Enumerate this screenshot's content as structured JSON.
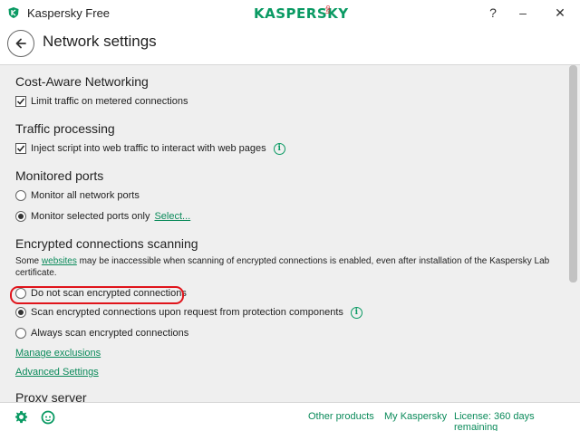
{
  "window": {
    "title": "Kaspersky Free",
    "logo_text": "KASPERSKY",
    "logo_suffix": "lab",
    "colors": {
      "brand_green": "#0a9a63",
      "brand_red": "#d7232a",
      "content_bg": "#efefef",
      "highlight": "#e0141b"
    }
  },
  "header": {
    "title": "Network settings"
  },
  "sections": {
    "cost_aware": {
      "title": "Cost-Aware Networking",
      "limit_traffic": {
        "label": "Limit traffic on metered connections",
        "checked": true
      }
    },
    "traffic_processing": {
      "title": "Traffic processing",
      "inject_script": {
        "label": "Inject script into web traffic to interact with web pages",
        "checked": true
      }
    },
    "monitored_ports": {
      "title": "Monitored ports",
      "all_ports": {
        "label": "Monitor all network ports",
        "selected": false
      },
      "selected_ports": {
        "label": "Monitor selected ports only",
        "selected": true,
        "link": "Select..."
      }
    },
    "encrypted": {
      "title": "Encrypted connections scanning",
      "desc_pre": "Some ",
      "desc_link": "websites",
      "desc_post": " may be inaccessible when scanning of encrypted connections is enabled, even after installation of the Kaspersky Lab certificate.",
      "do_not_scan": {
        "label": "Do not scan encrypted connections",
        "selected": false
      },
      "on_request": {
        "label": "Scan encrypted connections upon request from protection components",
        "selected": true
      },
      "always": {
        "label": "Always scan encrypted connections",
        "selected": false
      },
      "manage_exclusions": "Manage exclusions",
      "advanced_settings": "Advanced Settings"
    },
    "proxy": {
      "title": "Proxy server"
    }
  },
  "footer": {
    "other_products": "Other products",
    "my_kaspersky": "My Kaspersky",
    "license": "License: 360 days remaining"
  }
}
